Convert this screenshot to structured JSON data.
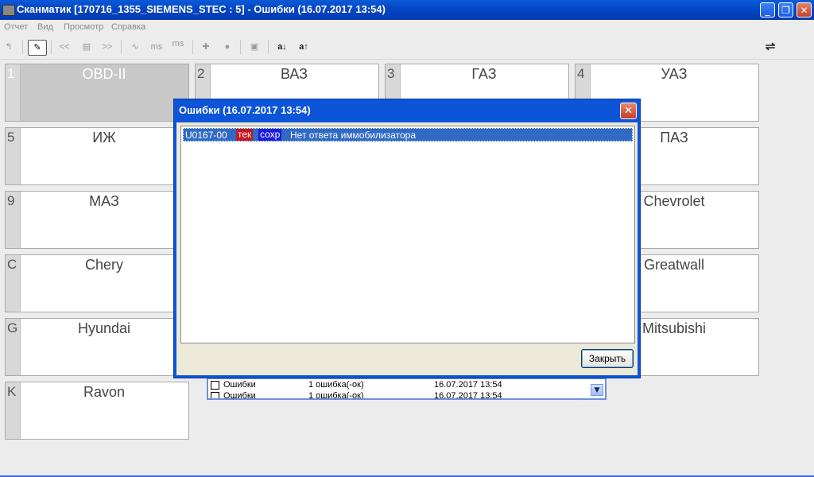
{
  "window": {
    "title": "Сканматик [170716_1355_SIEMENS_STEC : 5] - Ошибки (16.07.2017  13:54)",
    "minimize": "_",
    "maximize": "❐",
    "close": "✕"
  },
  "menu": [
    "Отчет",
    "Вид",
    "Просмотр",
    "Справка"
  ],
  "toolbar": {
    "back": "↰",
    "edit": "✎",
    "prev": "<<",
    "list": "▤",
    "next": ">>",
    "wave": "∿",
    "ms1": "ms",
    "ms2": "ms",
    "plus": "✚",
    "record": "●",
    "save": "▣",
    "sort_asc": "a↓",
    "sort_desc": "a↑",
    "usb": "⇌"
  },
  "tiles": [
    {
      "key": "1",
      "name": "OBD-II"
    },
    {
      "key": "2",
      "name": "ВАЗ"
    },
    {
      "key": "3",
      "name": "ГАЗ"
    },
    {
      "key": "4",
      "name": "УАЗ"
    },
    {
      "key": "5",
      "name": "ИЖ"
    },
    {
      "key": "",
      "name": "ПАЗ"
    },
    {
      "key": "9",
      "name": "МАЗ"
    },
    {
      "key": "",
      "name": "Chevrolet"
    },
    {
      "key": "C",
      "name": "Chery"
    },
    {
      "key": "",
      "name": "Greatwall"
    },
    {
      "key": "G",
      "name": "Hyundai"
    },
    {
      "key": "",
      "name": "Mitsubishi"
    },
    {
      "key": "K",
      "name": "Ravon"
    }
  ],
  "background_list": [
    {
      "type": "Ошибки",
      "status": "1 ошибка(-ок)",
      "date": "16.07.2017  13:54"
    },
    {
      "type": "Ошибки",
      "status": "1 ошибка(-ок)",
      "date": "16.07.2017  13:54"
    }
  ],
  "dialog": {
    "title": "Ошибки (16.07.2017  13:54)",
    "close": "✕",
    "errors": [
      {
        "code": "U0167-00",
        "current": "тек",
        "stored": "сохр",
        "description": "Нет ответа иммобилизатора"
      }
    ],
    "close_button": "Закрыть"
  },
  "colors": {
    "titlebar": "#0546c4",
    "selection": "#316ac5",
    "current_badge": "#c8161c",
    "stored_badge": "#1c1ce0"
  }
}
